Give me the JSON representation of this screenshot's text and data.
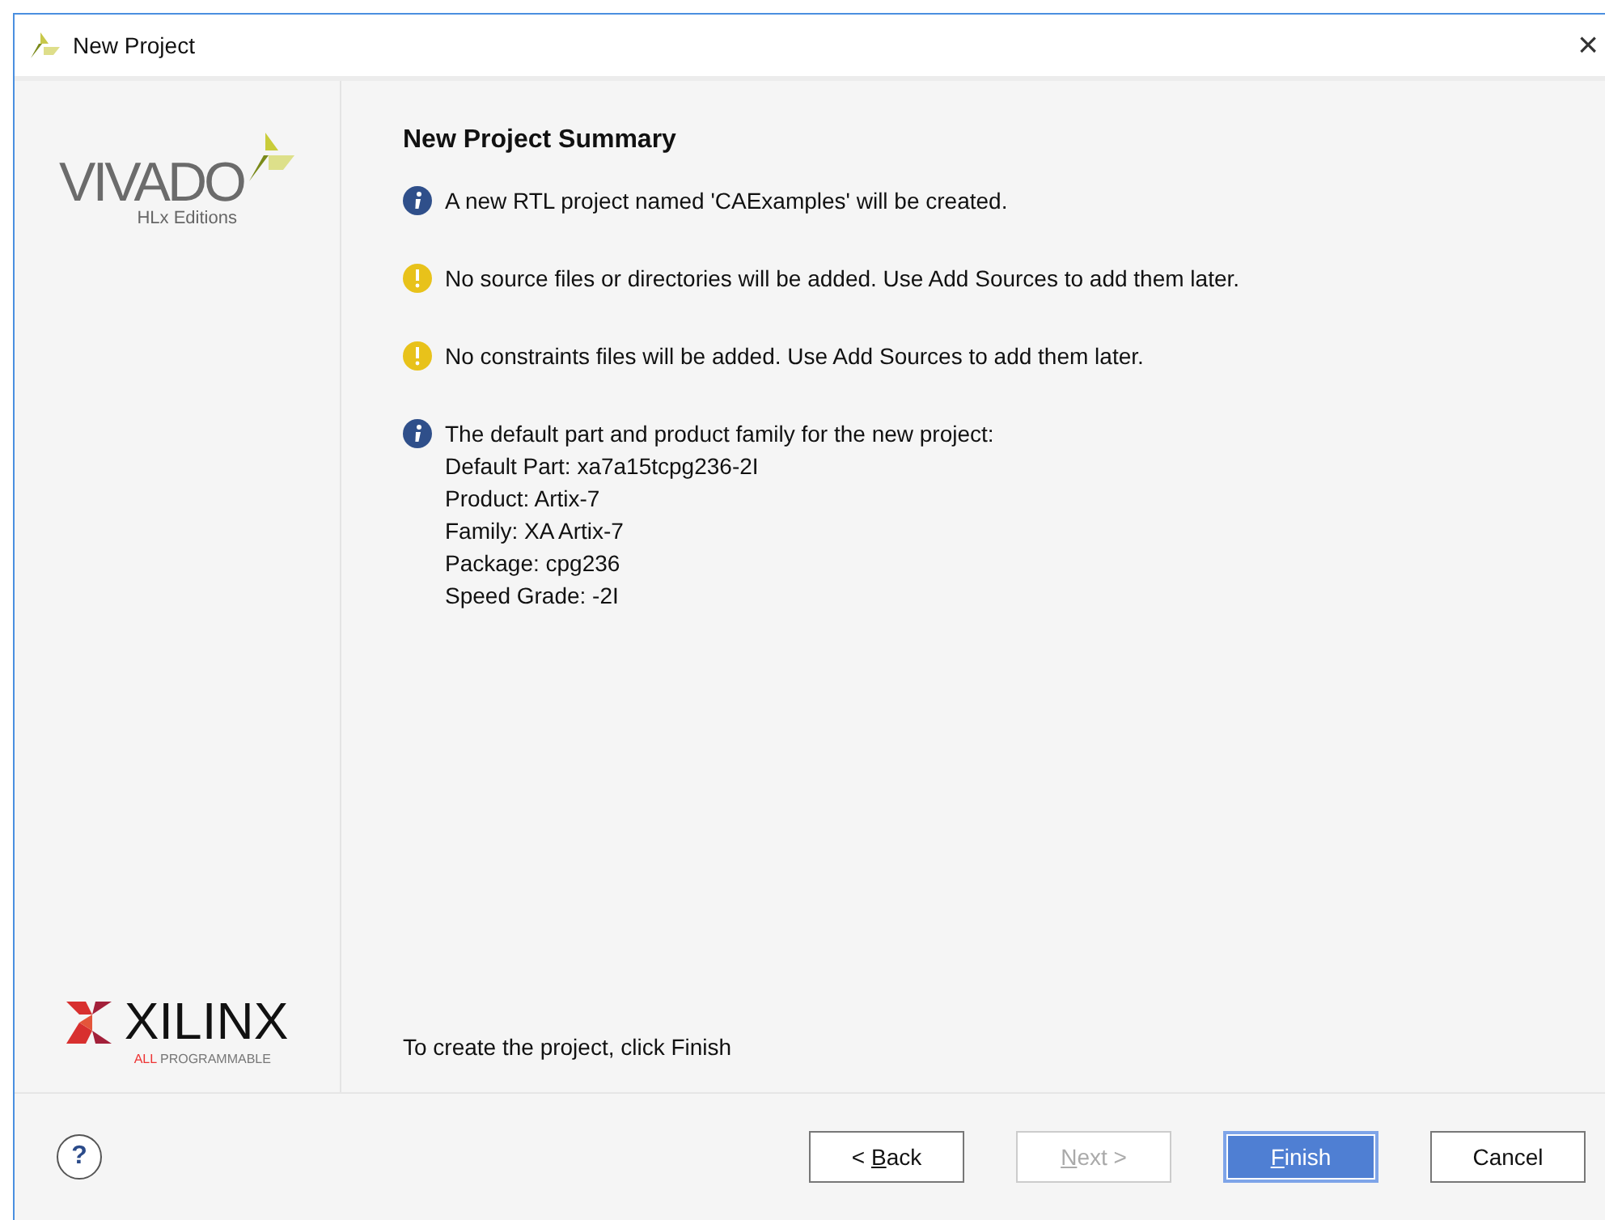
{
  "window": {
    "title": "New Project",
    "close": "×"
  },
  "sidebar": {
    "product_logo": {
      "name": "VIVADO",
      "edition": "HLx Editions"
    },
    "vendor_logo": {
      "name": "XILINX",
      "tagline_accent": "ALL",
      "tagline": "PROGRAMMABLE"
    }
  },
  "page": {
    "heading": "New Project Summary",
    "messages": [
      {
        "kind": "info",
        "lines": [
          "A new RTL project named 'CAExamples' will be created."
        ]
      },
      {
        "kind": "warning",
        "lines": [
          "No source files or directories will be added. Use Add Sources to add them later."
        ]
      },
      {
        "kind": "warning",
        "lines": [
          "No constraints files will be added. Use Add Sources to add them later."
        ]
      },
      {
        "kind": "info",
        "lines": [
          "The default part and product family for the new project:",
          "Default Part: xa7a15tcpg236-2I",
          "Product: Artix-7",
          "Family: XA Artix-7",
          "Package: cpg236",
          "Speed Grade: -2I"
        ]
      }
    ],
    "footer_note": "To create the project, click Finish"
  },
  "help": {
    "symbol": "?"
  },
  "buttons": [
    {
      "before": "< ",
      "key": "B",
      "after": "ack",
      "disabled": false,
      "default": false
    },
    {
      "key": "N",
      "after": "ext >",
      "disabled": true,
      "default": false
    },
    {
      "key": "F",
      "after": "inish",
      "disabled": false,
      "default": true
    },
    {
      "before": "Cancel",
      "disabled": false,
      "default": false
    }
  ]
}
